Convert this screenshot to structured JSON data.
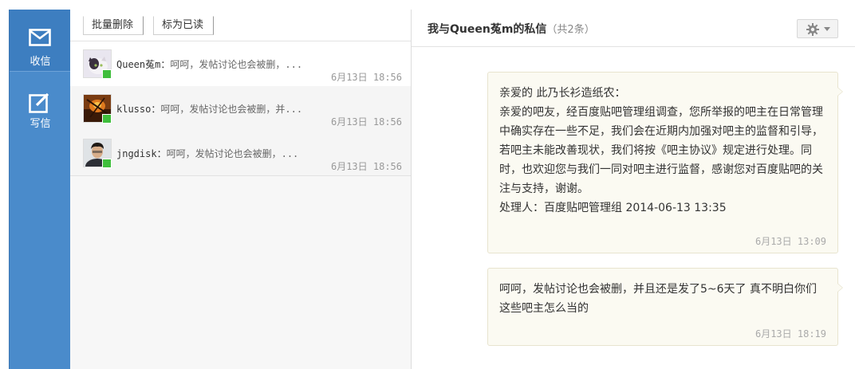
{
  "nav": {
    "inbox_label": "收信",
    "compose_label": "写信"
  },
  "toolbar": {
    "batch_delete_label": "批量删除",
    "mark_read_label": "标为已读"
  },
  "conversations": [
    {
      "name": "Queen菟m",
      "separator": "：",
      "preview": "呵呵，发帖讨论也会被删，...",
      "time": "6月13日 18:56",
      "online": true,
      "avatar_icon": "cat-avatar"
    },
    {
      "name": "klusso",
      "separator": "：",
      "preview": "呵呵，发帖讨论也会被删，并...",
      "time": "6月13日 18:56",
      "online": true,
      "avatar_icon": "fire-avatar"
    },
    {
      "name": "jngdisk",
      "separator": "：",
      "preview": "呵呵，发帖讨论也会被删，...",
      "time": "6月13日 18:56",
      "online": true,
      "avatar_icon": "person-avatar"
    }
  ],
  "thread": {
    "title": "我与Queen菟m的私信",
    "count": "（共2条）",
    "messages": [
      {
        "body": "亲爱的 此乃长衫造纸农：\n亲爱的吧友，经百度贴吧管理组调查，您所举报的吧主在日常管理中确实存在一些不足，我们会在近期内加强对吧主的监督和引导，若吧主未能改善现状，我们将按《吧主协议》规定进行处理。同时，也欢迎您与我们一同对吧主进行监督，感谢您对百度贴吧的关注与支持，谢谢。",
        "handler": "处理人：百度贴吧管理组 2014-06-13 13:35",
        "time": "6月13日 13:09"
      },
      {
        "body": "呵呵，发帖讨论也会被删，并且还是发了5~6天了 真不明白你们这些吧主怎么当的",
        "time": "6月13日 18:19"
      }
    ]
  },
  "colors": {
    "nav_bg": "#4a8bcb",
    "nav_active_bg": "#3d7ec0",
    "online_dot": "#3fbe3c",
    "bubble_bg": "#fbfaf2"
  }
}
